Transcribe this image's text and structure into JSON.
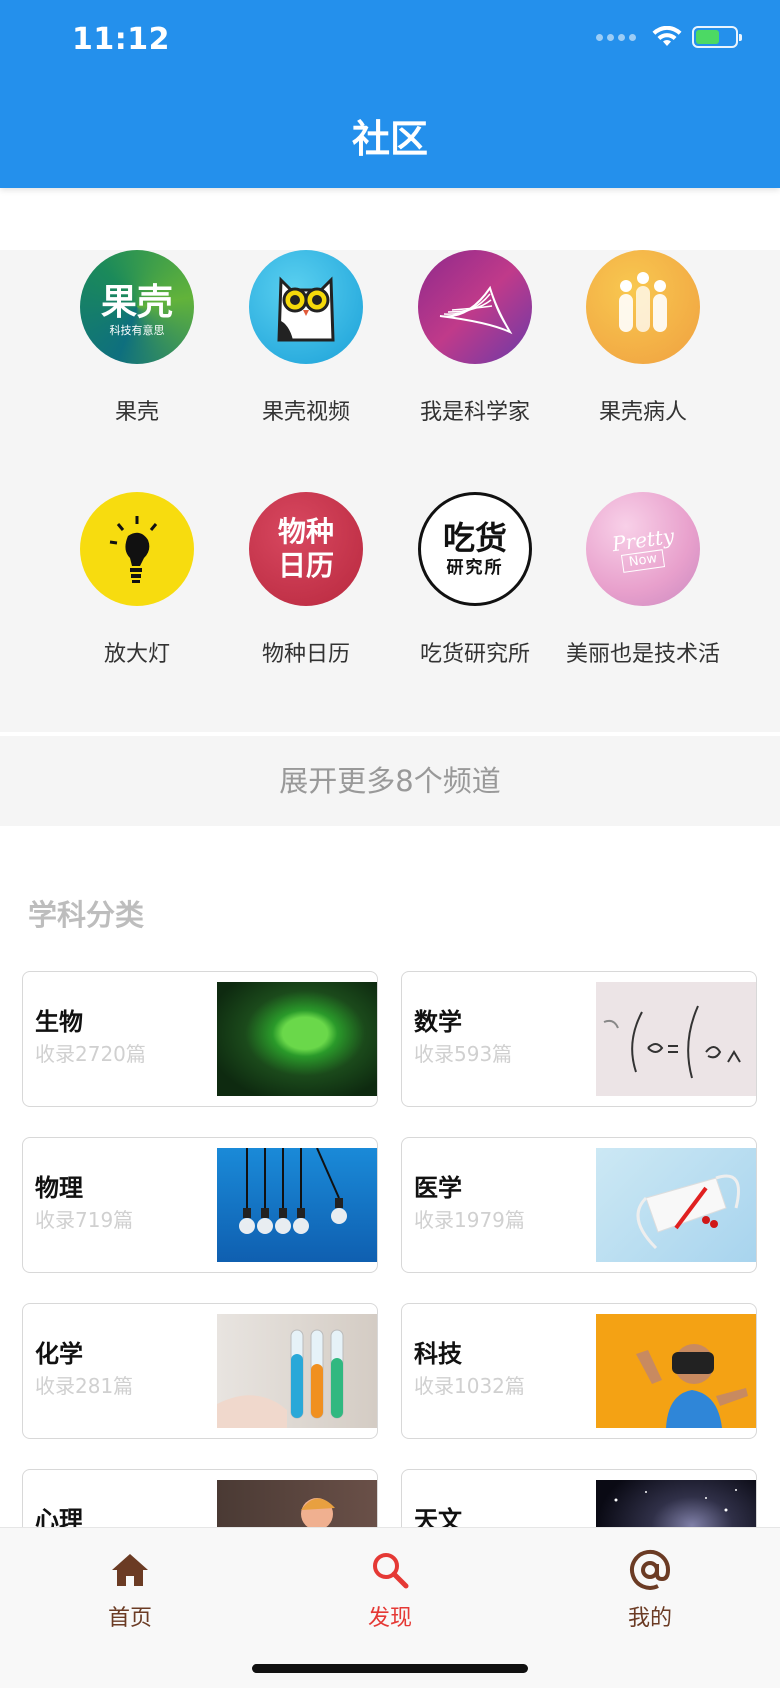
{
  "status_bar": {
    "time": "11:12"
  },
  "header": {
    "title": "社区"
  },
  "channels": [
    {
      "label": "果壳",
      "icon": "guokr-logo",
      "logo_main": "果壳",
      "logo_sub": "科技有意思"
    },
    {
      "label": "果壳视频",
      "icon": "owl-logo"
    },
    {
      "label": "我是科学家",
      "icon": "wave-logo"
    },
    {
      "label": "果壳病人",
      "icon": "patient-logo"
    },
    {
      "label": "放大灯",
      "icon": "lightbulb-logo"
    },
    {
      "label": "物种日历",
      "icon": "species-calendar-logo",
      "logo_main": "物种\n日历"
    },
    {
      "label": "吃货研究所",
      "icon": "foodie-logo",
      "logo_main": "吃货",
      "logo_sub": "研究所"
    },
    {
      "label": "美丽也是技术活",
      "icon": "pretty-now-logo",
      "logo_main": "Pretty",
      "logo_sub": "Now"
    }
  ],
  "expand_label": "展开更多8个频道",
  "section_title": "学科分类",
  "categories": [
    {
      "name": "生物",
      "count": "收录2720篇",
      "thumb": "frog-photo"
    },
    {
      "name": "数学",
      "count": "收录593篇",
      "thumb": "math-formula-photo"
    },
    {
      "name": "物理",
      "count": "收录719篇",
      "thumb": "pendulum-bulbs-photo"
    },
    {
      "name": "医学",
      "count": "收录1979篇",
      "thumb": "mask-syringe-photo"
    },
    {
      "name": "化学",
      "count": "收录281篇",
      "thumb": "test-tubes-photo"
    },
    {
      "name": "科技",
      "count": "收录1032篇",
      "thumb": "vr-headset-photo"
    },
    {
      "name": "心理",
      "count": "",
      "thumb": "stressed-woman-photo"
    },
    {
      "name": "天文",
      "count": "",
      "thumb": "galaxy-photo"
    }
  ],
  "tabbar": {
    "items": [
      {
        "label": "首页",
        "icon": "home-icon"
      },
      {
        "label": "发现",
        "icon": "search-icon"
      },
      {
        "label": "我的",
        "icon": "at-icon"
      }
    ]
  },
  "colors": {
    "header_bg": "#2490ec",
    "tab_active": "#e53935",
    "tab_inactive": "#6b3b24"
  }
}
